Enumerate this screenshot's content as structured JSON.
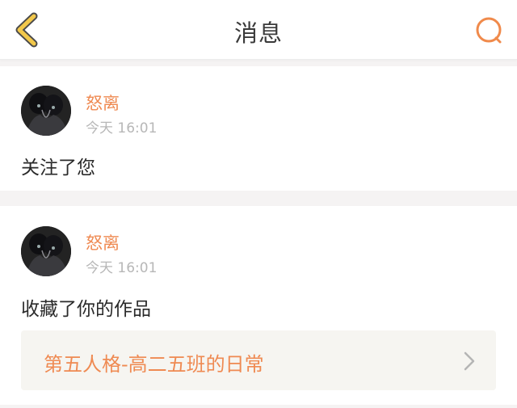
{
  "header": {
    "title": "消息",
    "back_icon": "chevron-left-icon",
    "search_icon": "search-icon",
    "accent": "#f08a4b"
  },
  "messages": [
    {
      "user": "怒离",
      "time": "今天 16:01",
      "text": "关注了您"
    },
    {
      "user": "怒离",
      "time": "今天 16:01",
      "text": "收藏了你的作品",
      "work_title": "第五人格-高二五班的日常"
    }
  ],
  "colors": {
    "username": "#ef8a52",
    "time": "#b7b7b7",
    "background": "#f5f3f3",
    "work_bg": "#f6f5f1"
  }
}
